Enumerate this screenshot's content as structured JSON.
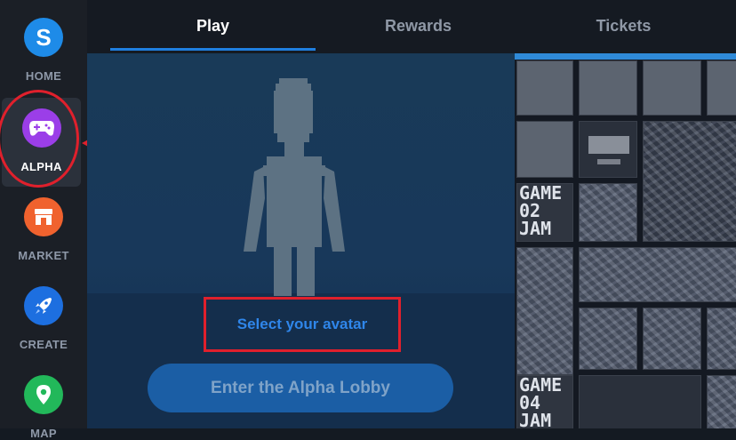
{
  "sidebar": {
    "items": [
      {
        "label": "HOME",
        "icon": "sandbox-s-icon",
        "color": "#1e8be8"
      },
      {
        "label": "ALPHA",
        "icon": "gamepad-icon",
        "color": "#9b3ee8"
      },
      {
        "label": "MARKET",
        "icon": "shop-icon",
        "color": "#f0622e"
      },
      {
        "label": "CREATE",
        "icon": "rocket-icon",
        "color": "#1d6fe0"
      },
      {
        "label": "MAP",
        "icon": "map-pin-icon",
        "color": "#22b85a"
      }
    ]
  },
  "tabs": [
    {
      "label": "Play",
      "active": true
    },
    {
      "label": "Rewards",
      "active": false
    },
    {
      "label": "Tickets",
      "active": false
    }
  ],
  "play": {
    "select_avatar": "Select your avatar",
    "enter_lobby": "Enter the Alpha Lobby"
  },
  "games": {
    "tiles": [
      {
        "label": ""
      },
      {
        "label": "GAME\n02\nJAM"
      },
      {
        "label": "GAME\n04\nJAM"
      }
    ]
  },
  "accent_colors": {
    "active_tab_underline": "#1f7fe0",
    "annotation_red": "#e0202c"
  }
}
